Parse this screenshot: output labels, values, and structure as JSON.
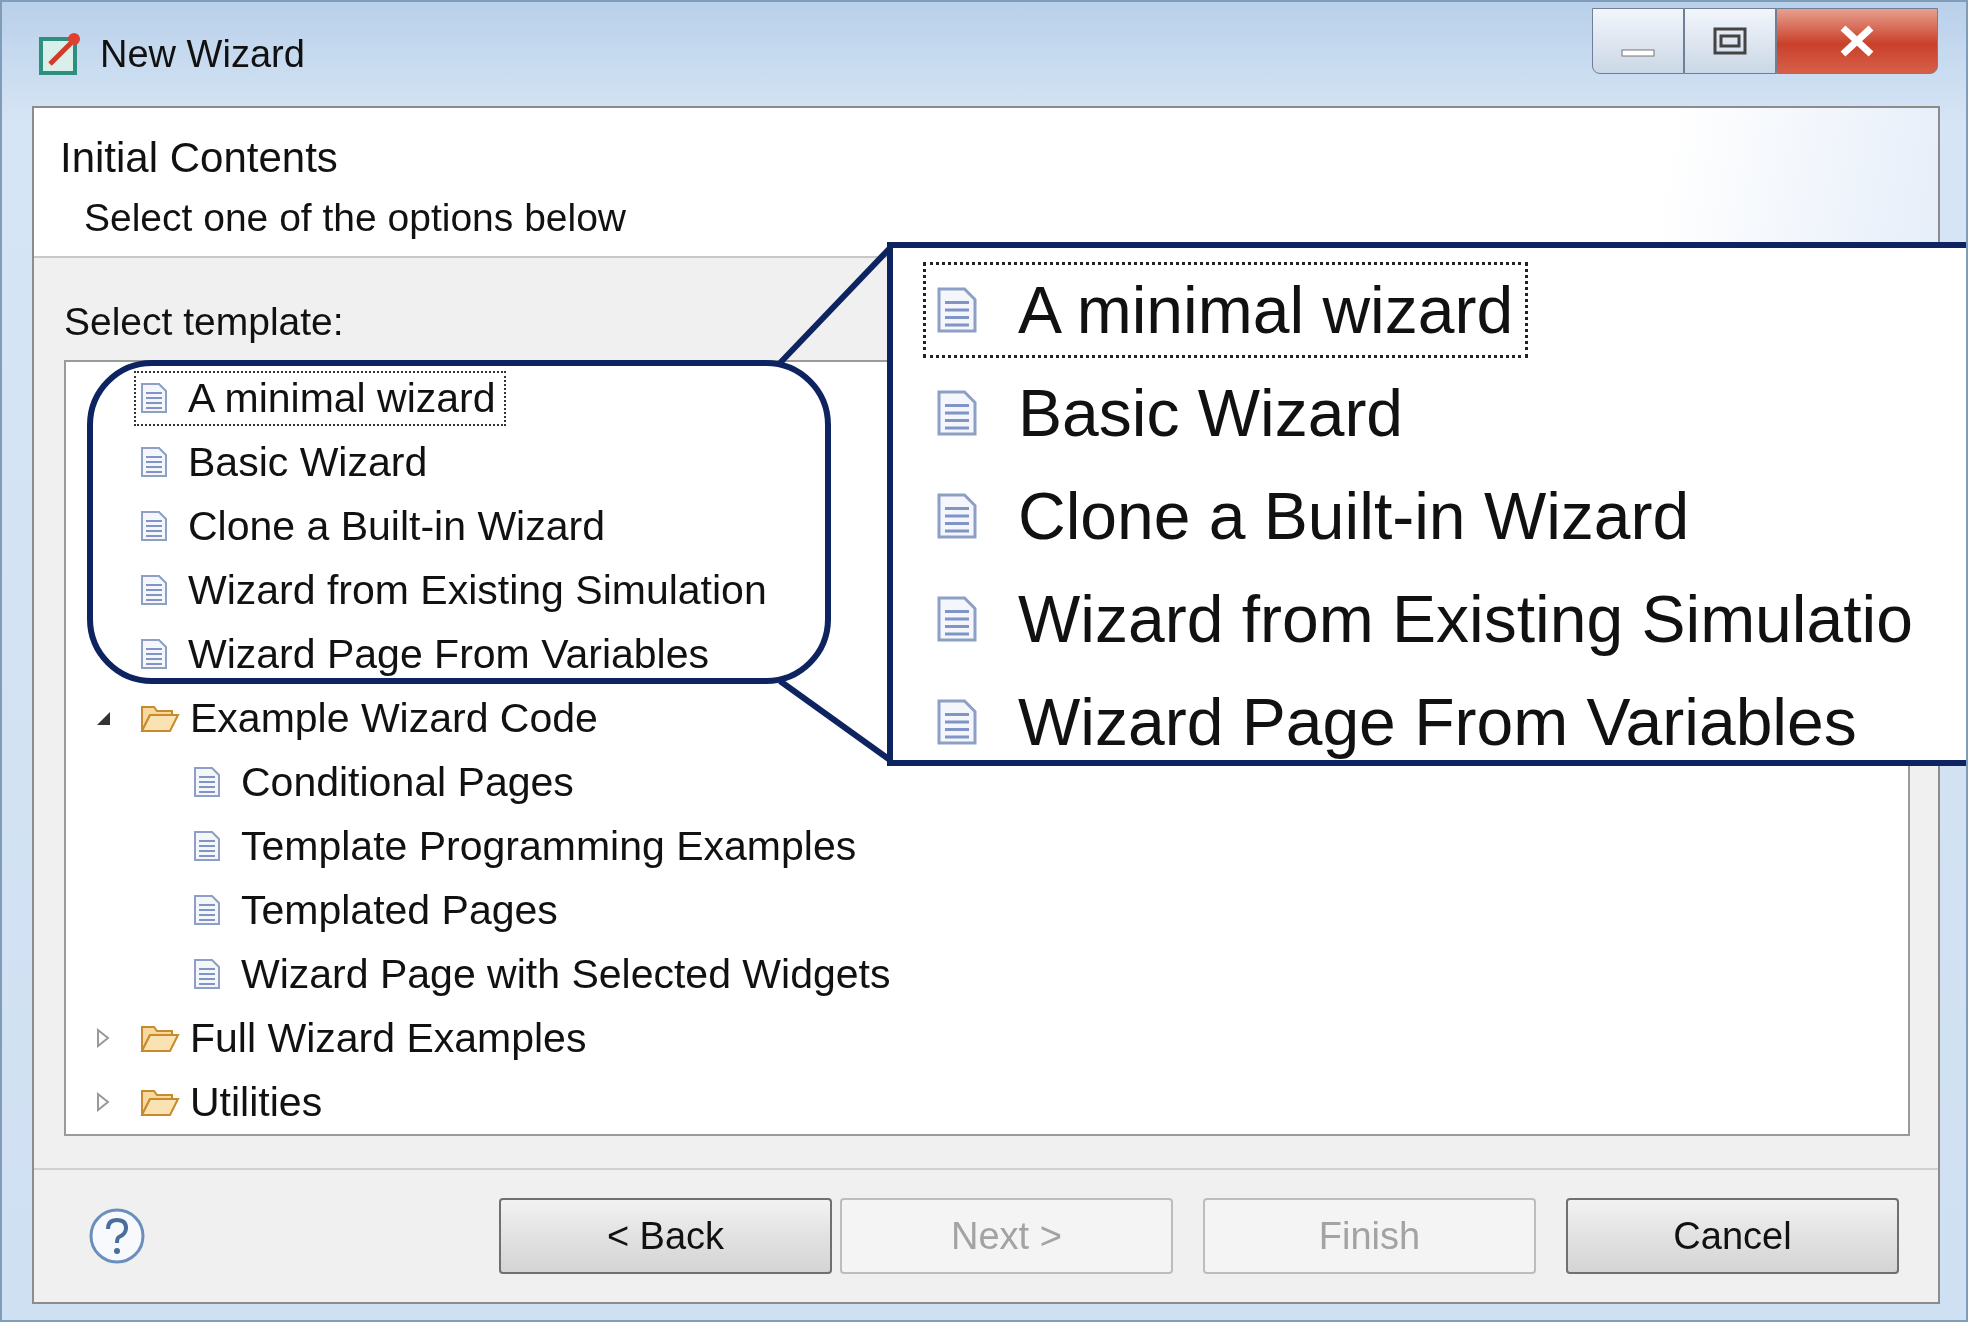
{
  "window": {
    "title": "New Wizard"
  },
  "header": {
    "title": "Initial Contents",
    "subtitle": "Select one of the options below"
  },
  "tree": {
    "label": "Select template:",
    "items": [
      {
        "label": "A minimal wizard",
        "kind": "file",
        "selected": true
      },
      {
        "label": "Basic Wizard",
        "kind": "file",
        "selected": false
      },
      {
        "label": "Clone a Built-in Wizard",
        "kind": "file",
        "selected": false
      },
      {
        "label": "Wizard from Existing Simulation",
        "kind": "file",
        "selected": false
      },
      {
        "label": "Wizard Page From Variables",
        "kind": "file",
        "selected": false
      },
      {
        "label": "Example Wizard Code",
        "kind": "folder",
        "expanded": true,
        "selected": false,
        "children": [
          {
            "label": "Conditional Pages",
            "kind": "file",
            "selected": false
          },
          {
            "label": "Template Programming Examples",
            "kind": "file",
            "selected": false
          },
          {
            "label": "Templated Pages",
            "kind": "file",
            "selected": false
          },
          {
            "label": "Wizard Page with Selected Widgets",
            "kind": "file",
            "selected": false
          }
        ]
      },
      {
        "label": "Full Wizard Examples",
        "kind": "folder",
        "expanded": false,
        "selected": false
      },
      {
        "label": "Utilities",
        "kind": "folder",
        "expanded": false,
        "selected": false
      }
    ]
  },
  "callout": {
    "items": [
      {
        "label": "A minimal wizard",
        "selected": true
      },
      {
        "label": "Basic Wizard",
        "selected": false
      },
      {
        "label": "Clone a Built-in Wizard",
        "selected": false
      },
      {
        "label": "Wizard from Existing Simulatio",
        "selected": false
      },
      {
        "label": "Wizard Page From Variables",
        "selected": false
      }
    ]
  },
  "buttons": [
    {
      "label": "< Back",
      "disabled": false
    },
    {
      "label": "Next >",
      "disabled": true
    },
    {
      "label": "Finish",
      "disabled": true
    },
    {
      "label": "Cancel",
      "disabled": false
    }
  ]
}
